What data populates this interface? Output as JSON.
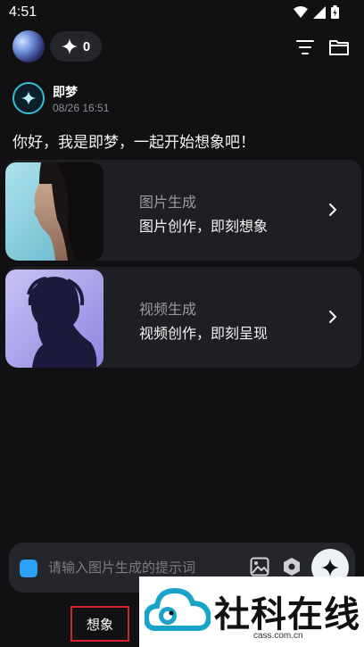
{
  "status_bar": {
    "time": "4:51"
  },
  "top_bar": {
    "credits": "0"
  },
  "bot": {
    "name": "即梦",
    "timestamp": "08/26 16:51"
  },
  "greeting": "你好，我是即梦，一起开始想象吧！",
  "cards": [
    {
      "title": "图片生成",
      "subtitle": "图片创作，即刻想象"
    },
    {
      "title": "视频生成",
      "subtitle": "视频创作，即刻呈现"
    }
  ],
  "input": {
    "placeholder": "请输入图片生成的提示词"
  },
  "bottom_tab": {
    "label": "想象"
  },
  "watermark": {
    "text": "社科在线",
    "url": "cass.com.cn"
  },
  "colors": {
    "accent_blue": "#2ea1f5",
    "highlight_red": "#d9202a",
    "bot_ring": "#2fc2d6"
  }
}
